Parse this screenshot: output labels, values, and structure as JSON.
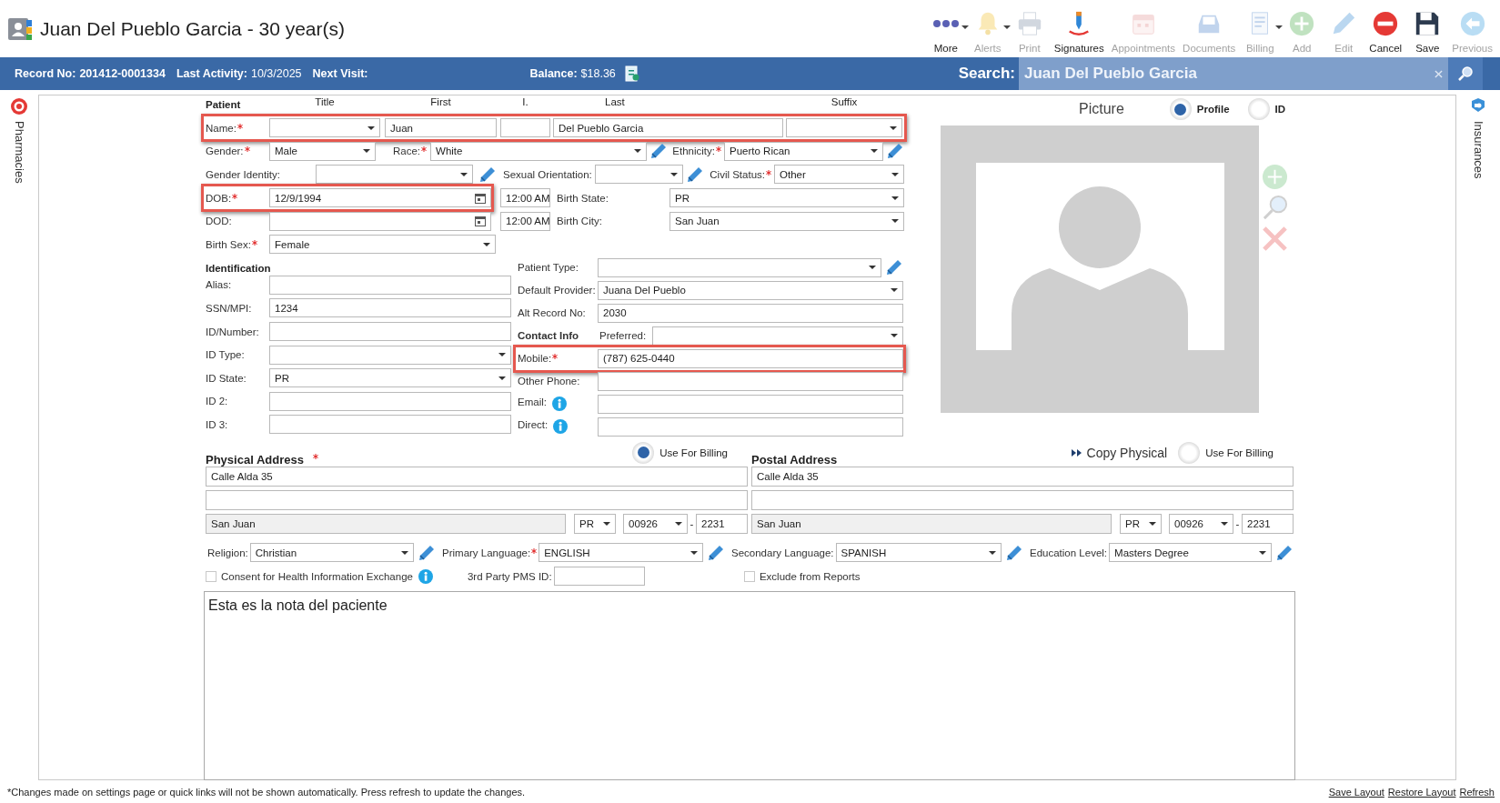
{
  "header": {
    "title": "Juan Del Pueblo Garcia - 30 year(s)",
    "toolbar": [
      {
        "label": "More",
        "disabled": false,
        "dropdown": true
      },
      {
        "label": "Alerts",
        "disabled": true,
        "dropdown": true
      },
      {
        "label": "Print",
        "disabled": true,
        "dropdown": false
      },
      {
        "label": "Signatures",
        "disabled": false,
        "dropdown": false
      },
      {
        "label": "Appointments",
        "disabled": true,
        "dropdown": false
      },
      {
        "label": "Documents",
        "disabled": true,
        "dropdown": false
      },
      {
        "label": "Billing",
        "disabled": true,
        "dropdown": true
      },
      {
        "label": "Add",
        "disabled": true,
        "dropdown": false
      },
      {
        "label": "Edit",
        "disabled": true,
        "dropdown": false
      },
      {
        "label": "Cancel",
        "disabled": false,
        "dropdown": false
      },
      {
        "label": "Save",
        "disabled": false,
        "dropdown": false
      },
      {
        "label": "Previous",
        "disabled": true,
        "dropdown": false
      }
    ]
  },
  "info_bar": {
    "record_label": "Record No:",
    "record_no": "201412-0001334",
    "last_activity_label": "Last Activity:",
    "last_activity": "10/3/2025",
    "next_visit_label": "Next Visit:",
    "balance_label": "Balance:",
    "balance": "$18.36",
    "search_label": "Search:",
    "search_value": "Juan Del Pueblo Garcia"
  },
  "side_tabs": [
    "Pharmacies",
    "Insurances"
  ],
  "patient": {
    "heading": "Patient",
    "name_columns": [
      "Title",
      "First",
      "I.",
      "Last",
      "Suffix"
    ],
    "name": {
      "label": "Name:",
      "required": true,
      "highlighted": true,
      "first": "Juan",
      "last": "Del Pueblo Garcia"
    },
    "gender": {
      "label": "Gender:",
      "required": true,
      "value": "Male"
    },
    "race": {
      "label": "Race:",
      "required": true,
      "value": "White"
    },
    "ethnicity": {
      "label": "Ethnicity:",
      "required": true,
      "value": "Puerto Rican"
    },
    "gender_identity": {
      "label": "Gender Identity:",
      "required": false
    },
    "sexual_orientation": {
      "label": "Sexual Orientation:",
      "required": false
    },
    "civil_status": {
      "label": "Civil Status:",
      "required": true,
      "value": "Other"
    },
    "dob": {
      "label": "DOB:",
      "required": true,
      "highlighted": true,
      "value": "12/9/1994",
      "time": "12:00 AM"
    },
    "birth_state": {
      "label": "Birth State:",
      "required": false,
      "value": "PR"
    },
    "dod": {
      "label": "DOD:",
      "required": false,
      "highlighted": false,
      "time": "12:00 AM"
    },
    "birth_city": {
      "label": "Birth City:",
      "required": false,
      "value": "San Juan"
    },
    "birth_sex": {
      "label": "Birth Sex:",
      "required": true,
      "value": "Female"
    }
  },
  "identification": {
    "heading": "Identification",
    "fields": [
      {
        "label": "Alias:",
        "kind": "text"
      },
      {
        "label": "SSN/MPI:",
        "kind": "text",
        "value": "1234"
      },
      {
        "label": "ID/Number:",
        "kind": "text"
      },
      {
        "label": "ID Type:",
        "kind": "select"
      },
      {
        "label": "ID State:",
        "kind": "select",
        "value": "PR"
      },
      {
        "label": "ID 2:",
        "kind": "text"
      },
      {
        "label": "ID 3:",
        "kind": "text"
      }
    ]
  },
  "practice": [
    {
      "label": "Patient Type:",
      "kind": "select",
      "editable": true
    },
    {
      "label": "Default Provider:",
      "kind": "select",
      "value": "Juana Del Pueblo"
    },
    {
      "label": "Alt Record No:",
      "kind": "text",
      "value": "2030"
    }
  ],
  "contact": {
    "heading": "Contact Info",
    "preferred_label": "Preferred:",
    "fields": [
      {
        "label": "Mobile:",
        "kind": "text",
        "required": true,
        "highlighted": true,
        "value": "(787) 625-0440"
      },
      {
        "label": "Other Phone:",
        "kind": "text"
      },
      {
        "label": "Email:",
        "kind": "text",
        "info": true
      },
      {
        "label": "Direct:",
        "kind": "text",
        "info": true
      }
    ]
  },
  "picture": {
    "heading": "Picture",
    "options": [
      {
        "label": "Profile",
        "selected": true
      },
      {
        "label": "ID",
        "selected": false
      }
    ]
  },
  "physical_address": {
    "heading": "Physical Address",
    "required": true,
    "billing": {
      "label": "Use For Billing",
      "selected": true
    },
    "line1": "Calle Alda 35",
    "city": "San Juan",
    "city_readonly": true,
    "state": "PR",
    "zip": "00926",
    "zip_separator": "-",
    "zip_ext": "2231"
  },
  "postal_address": {
    "heading": "Postal Address",
    "copy_label": "Copy Physical",
    "billing": {
      "label": "Use For Billing",
      "selected": false
    },
    "line1": "Calle Alda 35",
    "city": "San Juan",
    "city_readonly": true,
    "state": "PR",
    "zip": "00926",
    "zip_separator": "-",
    "zip_ext": "2231"
  },
  "demographics": [
    {
      "label": "Religion:",
      "required": false,
      "value": "Christian"
    },
    {
      "label": "Primary Language:",
      "required": true,
      "value": "ENGLISH"
    },
    {
      "label": "Secondary Language:",
      "required": false,
      "value": "SPANISH"
    },
    {
      "label": "Education Level:",
      "required": false,
      "value": "Masters Degree"
    }
  ],
  "options": {
    "consent": {
      "label": "Consent for Health Information Exchange",
      "checked": false
    },
    "third_party_label": "3rd Party PMS ID:",
    "exclude": {
      "label": "Exclude from Reports",
      "checked": false
    }
  },
  "notes": "Esta es la nota del paciente",
  "footer": {
    "note": "*Changes made on settings page or quick links will not be shown automatically. Press refresh to update the changes.",
    "links": [
      "Save Layout",
      "Restore Layout",
      "Refresh"
    ]
  }
}
